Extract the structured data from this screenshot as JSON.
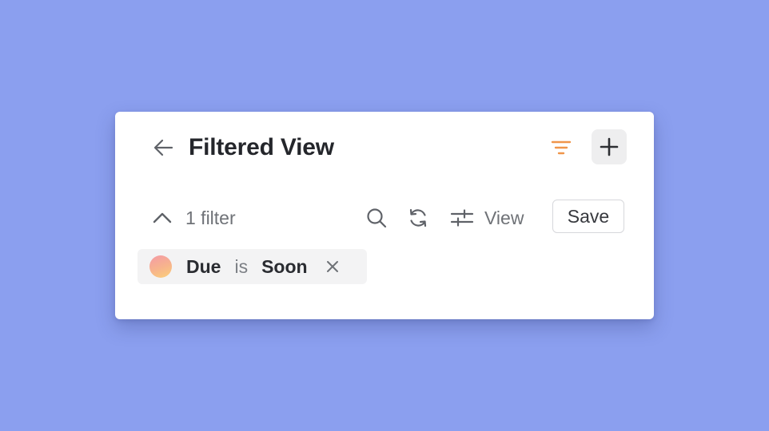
{
  "header": {
    "title": "Filtered View",
    "back_icon": "arrow-left-icon",
    "filter_icon": "filter-icon",
    "add_icon": "plus-icon"
  },
  "toolbar": {
    "filter_count_label": "1 filter",
    "collapse_icon": "chevron-up-icon",
    "search_icon": "search-icon",
    "refresh_icon": "refresh-icon",
    "view_icon": "sliders-icon",
    "view_label": "View",
    "save_label": "Save"
  },
  "filters": [
    {
      "field": "Due",
      "operator": "is",
      "value": "Soon",
      "remove_icon": "close-icon"
    }
  ],
  "colors": {
    "background": "#8b9fef",
    "card": "#ffffff",
    "accent_filter": "#f0954a",
    "chip_background": "#f3f3f4",
    "add_button_background": "#eeeeef"
  }
}
